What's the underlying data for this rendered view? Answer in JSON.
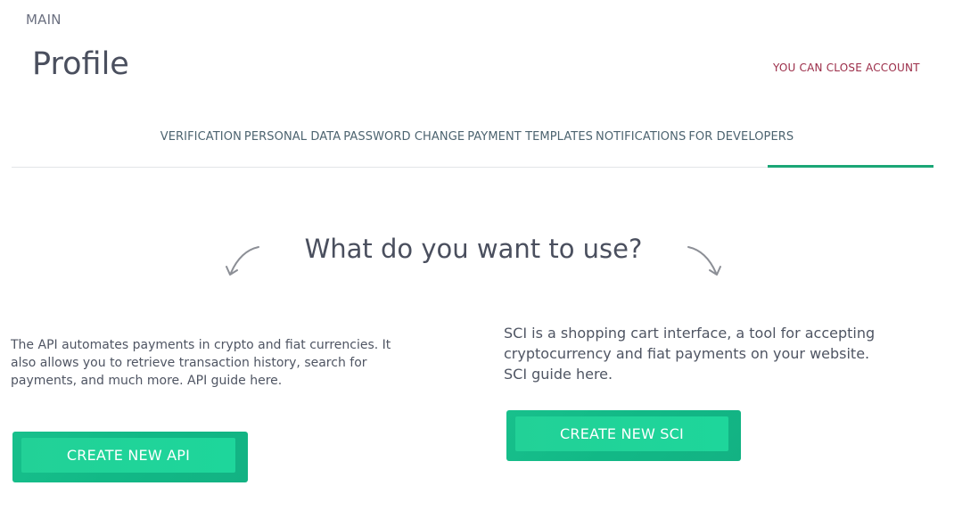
{
  "breadcrumb": "MAIN",
  "page_title": "Profile",
  "close_account_link": "YOU CAN CLOSE ACCOUNT",
  "tabs": [
    {
      "label": "VERIFICATION"
    },
    {
      "label": "PERSONAL DATA"
    },
    {
      "label": "PASSWORD CHANGE"
    },
    {
      "label": "PAYMENT TEMPLATES"
    },
    {
      "label": "NOTIFICATIONS"
    },
    {
      "label": "FOR DEVELOPERS",
      "active": true
    }
  ],
  "question": "What do you want to use?",
  "api": {
    "description": "The API automates payments in crypto and fiat currencies. It also allows you to retrieve transaction history, search for payments, and much more. API guide here.",
    "button_label": "CREATE NEW API"
  },
  "sci": {
    "description": "SCI is a shopping cart interface, a tool for accepting cryptocurrency and fiat payments on your website. SCI guide here.",
    "button_label": "CREATE NEW SCI"
  },
  "colors": {
    "accent": "#1aa676",
    "button": "#18c08c",
    "link": "#9b2c48"
  },
  "icons": [
    "arrow-down-left-icon",
    "arrow-down-right-icon"
  ]
}
